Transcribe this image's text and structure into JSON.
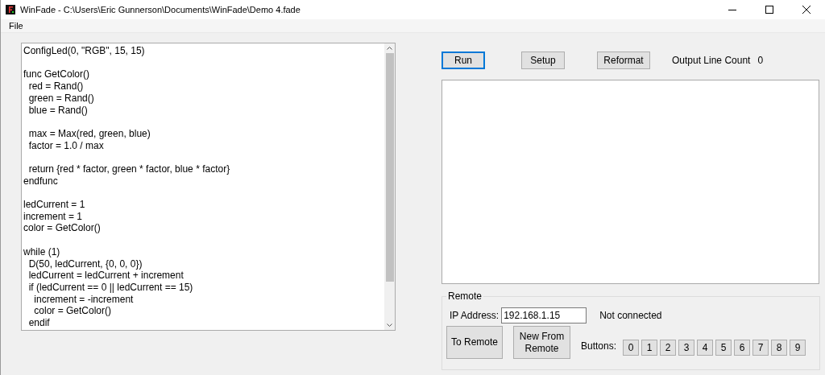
{
  "window": {
    "title": "WinFade - C:\\Users\\Eric Gunnerson\\Documents\\WinFade\\Demo 4.fade"
  },
  "menu": [
    "File"
  ],
  "editor": {
    "blocks": [
      [
        "ConfigLed(0, \"RGB\", 15, 15)"
      ],
      [
        "func GetColor()",
        "  red = Rand()",
        "  green = Rand()",
        "  blue = Rand()"
      ],
      [
        "  max = Max(red, green, blue)",
        "  factor = 1.0 / max"
      ],
      [
        "  return {red * factor, green * factor, blue * factor}",
        "endfunc"
      ],
      [
        "ledCurrent = 1",
        "increment = 1",
        "color = GetColor()"
      ],
      [
        "while (1)",
        "  D(50, ledCurrent, {0, 0, 0})",
        "  ledCurrent = ledCurrent + increment",
        "  if (ledCurrent == 0 || ledCurrent == 15)",
        "    increment = -increment",
        "    color = GetColor()",
        "  endif"
      ]
    ]
  },
  "toolbar": [
    {
      "label": "Run",
      "focused": true
    },
    {
      "label": "Setup",
      "focused": false
    },
    {
      "label": "Reformat",
      "focused": false
    }
  ],
  "output_line_count": {
    "label": "Output Line Count",
    "value": "0"
  },
  "remote": {
    "title": "Remote",
    "ip_label": "IP Address:",
    "ip_value": "192.168.1.15",
    "status": "Not connected",
    "actions": [
      "To Remote",
      "New From Remote"
    ],
    "buttons_label": "Buttons:",
    "buttons": [
      "0",
      "1",
      "2",
      "3",
      "4",
      "5",
      "6",
      "7",
      "8",
      "9"
    ]
  }
}
